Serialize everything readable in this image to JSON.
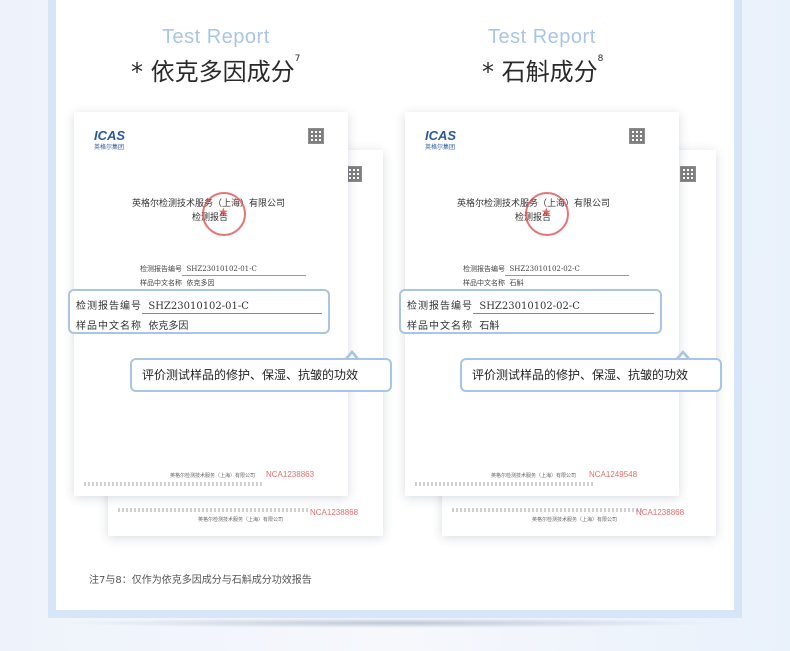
{
  "sections": [
    {
      "en_title": "Test Report",
      "cn_title": "* 依克多因成分",
      "ref": "7",
      "front": {
        "logo": "ICAS",
        "logo_sub": "英格尔集团",
        "company": "英格尔检测技术服务（上海）有限公司",
        "report_title": "检测报告",
        "field1_label": "检测报告编号",
        "field1_value": "SHZ23010102-01-C",
        "field2_label": "样品中文名称",
        "field2_value": "依克多因",
        "footer_cn": "英格尔检测技术服务（上海）有限公司",
        "nca": "NCA1238863"
      },
      "back": {
        "nca": "NCA1238868",
        "footer_cn": "英格尔检测技术服务（上海）有限公司"
      },
      "zoom": {
        "field1_label": "检测报告编号",
        "field1_value": "SHZ23010102-01-C",
        "field2_label": "样品中文名称",
        "field2_value": "依克多因"
      },
      "callout": "评价测试样品的修护、保湿、抗皱的功效"
    },
    {
      "en_title": "Test Report",
      "cn_title": "* 石斛成分",
      "ref": "8",
      "front": {
        "logo": "ICAS",
        "logo_sub": "英格尔集团",
        "company": "英格尔检测技术服务（上海）有限公司",
        "report_title": "检测报告",
        "field1_label": "检测报告编号",
        "field1_value": "SHZ23010102-02-C",
        "field2_label": "样品中文名称",
        "field2_value": "石斛",
        "footer_cn": "英格尔检测技术服务（上海）有限公司",
        "nca": "NCA1249548"
      },
      "back": {
        "nca": "NCA1238868",
        "footer_cn": "英格尔检测技术服务（上海）有限公司"
      },
      "zoom": {
        "field1_label": "检测报告编号",
        "field1_value": "SHZ23010102-02-C",
        "field2_label": "样品中文名称",
        "field2_value": "石斛"
      },
      "callout": "评价测试样品的修护、保湿、抗皱的功效"
    }
  ],
  "note": "注7与8：仅作为依克多因成分与石斛成分功效报告",
  "colors": {
    "accent": "#a8c4e6",
    "frame": "#d6e5f7",
    "seal": "#dc4646",
    "nca": "#e56c6c"
  }
}
